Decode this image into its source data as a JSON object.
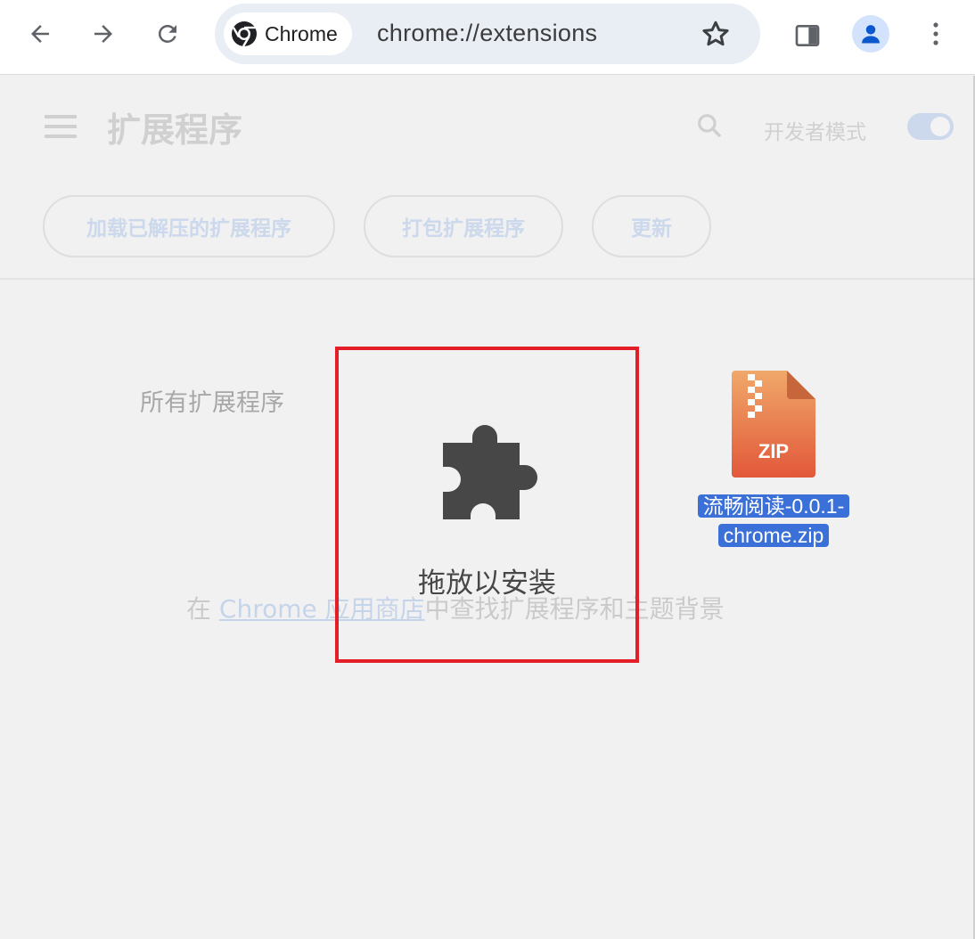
{
  "browser": {
    "chip_label": "Chrome",
    "url": "chrome://extensions"
  },
  "extensions_page": {
    "title": "扩展程序",
    "developer_mode_label": "开发者模式",
    "developer_mode_on": true,
    "buttons": {
      "load_unpacked": "加载已解压的扩展程序",
      "pack": "打包扩展程序",
      "update": "更新"
    },
    "all_extensions": "所有扩展程序",
    "store_prefix": "在 ",
    "store_link": "Chrome 应用商店",
    "store_suffix": "中查找扩展程序和主题背景"
  },
  "drop_zone": {
    "label": "拖放以安装"
  },
  "dragged_file": {
    "type_badge": "ZIP",
    "name_line1": "流畅阅读-0.0.1-",
    "name_line2": "chrome.zip"
  },
  "colors": {
    "accent": "#0b57d0",
    "drop_zone_border": "#e41e26",
    "file_selection": "#3b70d8"
  }
}
